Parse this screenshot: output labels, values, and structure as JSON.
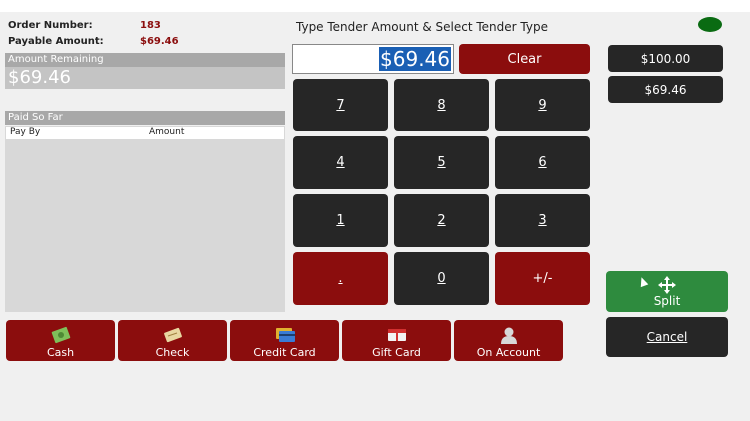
{
  "order": {
    "number_label": "Order Number:",
    "number_value": "183",
    "payable_label": "Payable Amount:",
    "payable_value": "$69.46"
  },
  "remaining": {
    "header": "Amount Remaining",
    "value": "$69.46"
  },
  "paid": {
    "header": "Paid So Far",
    "columns": [
      "Pay By",
      "Amount"
    ]
  },
  "prompt": "Type Tender Amount & Select Tender Type",
  "amount_input": "$69.46",
  "clear_label": "Clear",
  "keypad": [
    "7",
    "8",
    "9",
    "4",
    "5",
    "6",
    "1",
    "2",
    "3",
    ".",
    "0",
    "+/-"
  ],
  "quick_amounts": [
    "$100.00",
    "$69.46"
  ],
  "tenders": [
    "Cash",
    "Check",
    "Credit Card",
    "Gift Card",
    "On Account"
  ],
  "split_label": "Split",
  "cancel_label": "Cancel",
  "colors": {
    "accent_red": "#8b0d0d",
    "key_dark": "#262626",
    "split_green": "#2e8b3e",
    "status_green": "#0a6b12",
    "selection_blue": "#1a5fb4"
  },
  "icons": [
    "cash-icon",
    "check-icon",
    "credit-card-icon",
    "gift-card-icon",
    "on-account-icon",
    "move-arrows-icon",
    "status-indicator"
  ]
}
